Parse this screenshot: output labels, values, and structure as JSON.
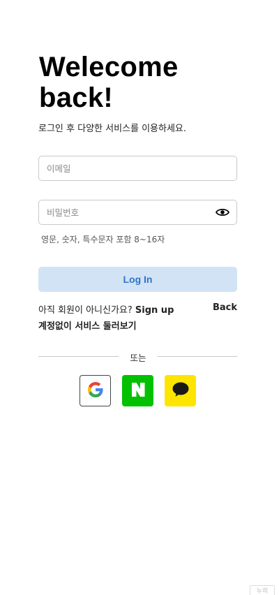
{
  "header": {
    "title": "Welecome back!",
    "subtitle": "로그인 후 다양한 서비스를 이용하세요."
  },
  "form": {
    "email_placeholder": "이메일",
    "password_placeholder": "비밀번호",
    "password_hint": "영문, 숫자, 특수문자 포함 8~16자",
    "login_label": "Log In"
  },
  "links": {
    "signup_question": "아직 회원이 아니신가요?",
    "signup_label": "Sign up",
    "back_label": "Back",
    "guest_label": "계정없이 서비스 둘러보기"
  },
  "divider": {
    "label": "또는"
  },
  "social": {
    "google_icon": "google-logo",
    "naver_icon": "naver-logo",
    "kakao_icon": "kakao-logo",
    "naver_color": "#03c100",
    "kakao_color": "#fee500"
  },
  "colors": {
    "login_bg": "#d2e3f6",
    "login_text": "#2f74c7"
  },
  "corner_tag": "누히"
}
